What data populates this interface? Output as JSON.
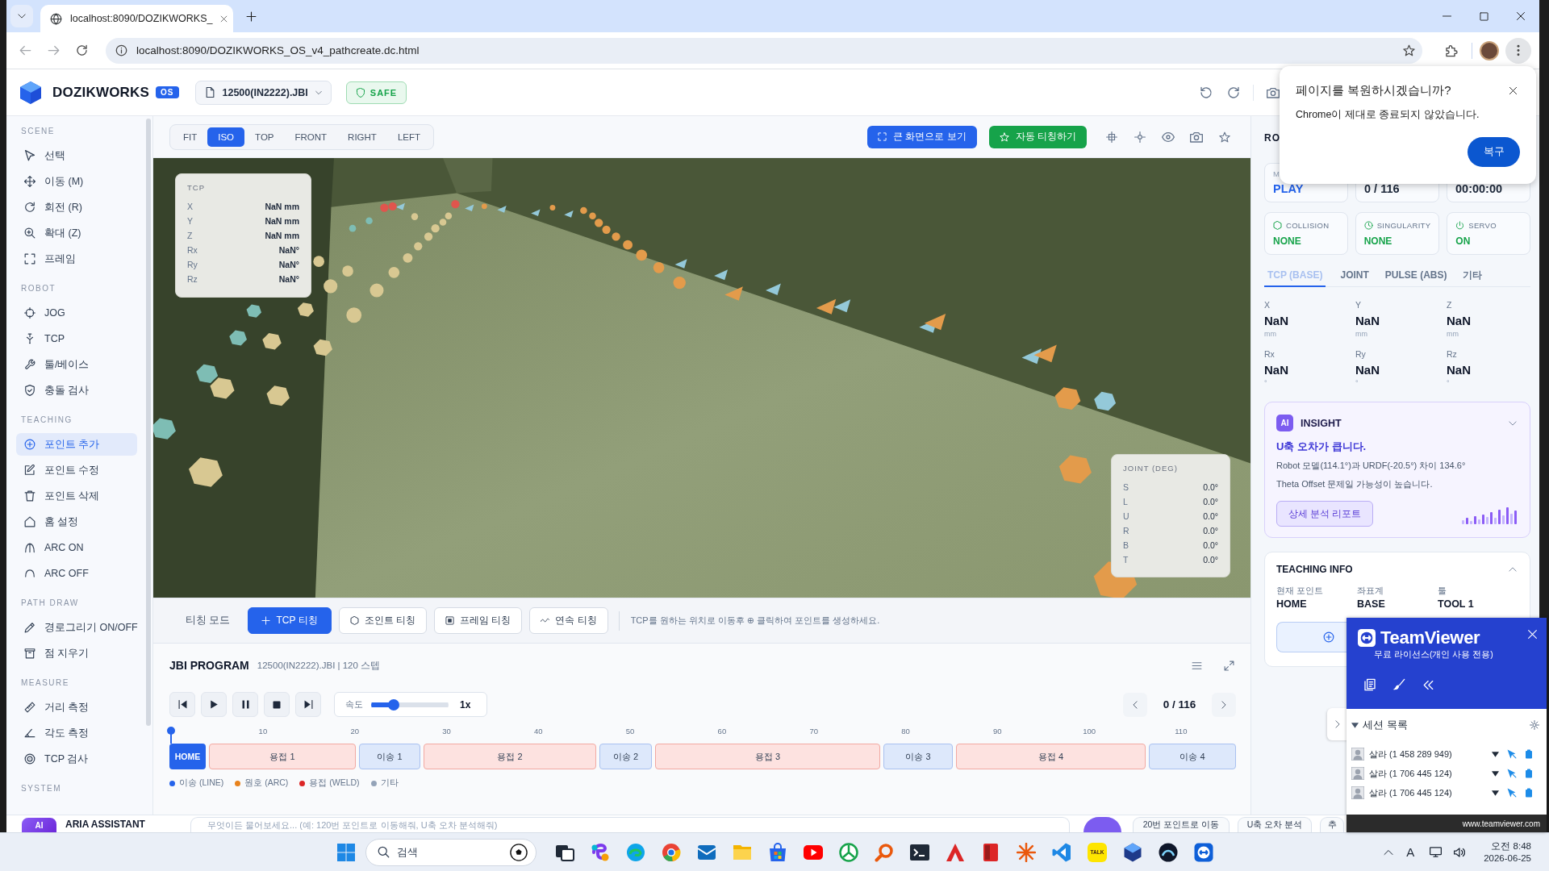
{
  "browser": {
    "tab_title": "localhost:8090/DOZIKWORKS_",
    "url": "localhost:8090/DOZIKWORKS_OS_v4_pathcreate.dc.html",
    "back_disabled": true,
    "forward_disabled": true
  },
  "header": {
    "brand": "DOZIKWORKS",
    "badge": "OS",
    "file": "12500(IN2222).JBI",
    "status": "SAFE"
  },
  "sidebar": {
    "sections": [
      {
        "title": "SCENE",
        "items": [
          {
            "label": "선택",
            "selected": false
          },
          {
            "label": "이동 (M)",
            "selected": false
          },
          {
            "label": "회전 (R)",
            "selected": false
          },
          {
            "label": "확대 (Z)",
            "selected": false
          },
          {
            "label": "프레임",
            "selected": false
          }
        ]
      },
      {
        "title": "ROBOT",
        "items": [
          {
            "label": "JOG",
            "selected": false
          },
          {
            "label": "TCP",
            "selected": false
          },
          {
            "label": "툴/베이스",
            "selected": false
          },
          {
            "label": "충돌 검사",
            "selected": false
          }
        ]
      },
      {
        "title": "TEACHING",
        "items": [
          {
            "label": "포인트 추가",
            "selected": true
          },
          {
            "label": "포인트 수정",
            "selected": false
          },
          {
            "label": "포인트 삭제",
            "selected": false
          },
          {
            "label": "홈 설정",
            "selected": false
          },
          {
            "label": "ARC ON",
            "selected": false
          },
          {
            "label": "ARC OFF",
            "selected": false
          }
        ]
      },
      {
        "title": "PATH DRAW",
        "items": [
          {
            "label": "경로그리기 ON/OFF",
            "selected": false
          },
          {
            "label": "점 지우기",
            "selected": false
          }
        ]
      },
      {
        "title": "MEASURE",
        "items": [
          {
            "label": "거리 측정",
            "selected": false
          },
          {
            "label": "각도 측정",
            "selected": false
          },
          {
            "label": "TCP 검사",
            "selected": false
          }
        ]
      },
      {
        "title": "SYSTEM"
      }
    ]
  },
  "view_toolbar": {
    "views": [
      {
        "label": "FIT",
        "selected": false
      },
      {
        "label": "ISO",
        "selected": true
      },
      {
        "label": "TOP",
        "selected": false
      },
      {
        "label": "FRONT",
        "selected": false
      },
      {
        "label": "RIGHT",
        "selected": false
      },
      {
        "label": "LEFT",
        "selected": false
      }
    ],
    "fullscreen_button": "큰 화면으로 보기",
    "auto_teach_button": "자동 티칭하기"
  },
  "viewport": {
    "tcp": {
      "title": "TCP",
      "rows": [
        {
          "axis": "X",
          "value": "NaN mm"
        },
        {
          "axis": "Y",
          "value": "NaN mm"
        },
        {
          "axis": "Z",
          "value": "NaN mm"
        },
        {
          "axis": "Rx",
          "value": "NaN°"
        },
        {
          "axis": "Ry",
          "value": "NaN°"
        },
        {
          "axis": "Rz",
          "value": "NaN°"
        }
      ]
    },
    "joint": {
      "title": "JOINT (DEG)",
      "rows": [
        {
          "axis": "S",
          "value": "0.0°"
        },
        {
          "axis": "L",
          "value": "0.0°"
        },
        {
          "axis": "U",
          "value": "0.0°"
        },
        {
          "axis": "R",
          "value": "0.0°"
        },
        {
          "axis": "B",
          "value": "0.0°"
        },
        {
          "axis": "T",
          "value": "0.0°"
        }
      ]
    }
  },
  "teach_bar": {
    "label": "티칭 모드",
    "modes": [
      {
        "label": "TCP 티칭",
        "selected": true
      },
      {
        "label": "조인트 티칭",
        "selected": false
      },
      {
        "label": "프레임 티칭",
        "selected": false
      },
      {
        "label": "연속 티칭",
        "selected": false
      }
    ],
    "hint": "TCP를 원하는 위치로 이동후 ⊕ 클릭하여 포인트를 생성하세요."
  },
  "program": {
    "title": "JBI PROGRAM",
    "subtitle": "12500(IN2222).JBI | 120 스텝",
    "speed": {
      "label": "속도",
      "level": 0.26,
      "value": "1x"
    },
    "position": "0 / 116",
    "ticks": [
      "10",
      "20",
      "30",
      "40",
      "50",
      "60",
      "70",
      "80",
      "90",
      "100",
      "110"
    ],
    "playhead": {
      "level": 0
    },
    "segments": [
      {
        "label": "HOME",
        "kind": "home"
      },
      {
        "label": "용접 1",
        "kind": "weld"
      },
      {
        "label": "이송 1",
        "kind": "move"
      },
      {
        "label": "용접 2",
        "kind": "weld"
      },
      {
        "label": "이송 2",
        "kind": "move"
      },
      {
        "label": "용접 3",
        "kind": "weld"
      },
      {
        "label": "이송 3",
        "kind": "move"
      },
      {
        "label": "용접 4",
        "kind": "weld"
      },
      {
        "label": "이송 4",
        "kind": "move"
      }
    ],
    "legend": [
      {
        "label": "이송 (LINE)",
        "color": "#2563eb"
      },
      {
        "label": "원호 (ARC)",
        "color": "#e8821c"
      },
      {
        "label": "용접 (WELD)",
        "color": "#dc2626"
      },
      {
        "label": "기타",
        "color": "#94a3b8"
      }
    ]
  },
  "assistant": {
    "avatar": "AI",
    "title": "ARIA ASSISTANT",
    "placeholder": "무엇이든 물어보세요... (예: 120번 포인트로 이동해줘, U축 오차 분석해줘)",
    "chips": [
      "20번 포인트로 이동",
      "U축 오차 분석",
      "추"
    ]
  },
  "right_panel": {
    "title": "RO",
    "readouts": [
      {
        "label": "M",
        "value": "PLAY",
        "color": "#2563eb"
      },
      {
        "value": "0 / 116",
        "color": "#1e293b"
      },
      {
        "value": "00:00:00",
        "color": "#1e293b"
      }
    ],
    "checks": [
      {
        "label": "COLLISION",
        "value": "NONE"
      },
      {
        "label": "SINGULARITY",
        "value": "NONE"
      },
      {
        "label": "SERVO",
        "value": "ON"
      }
    ],
    "tabs": [
      {
        "label": "TCP (BASE)",
        "selected": true
      },
      {
        "label": "JOINT",
        "selected": false
      },
      {
        "label": "PULSE (ABS)",
        "selected": false
      },
      {
        "label": "기타",
        "selected": false
      }
    ],
    "coordinates": [
      {
        "label": "X",
        "value": "NaN",
        "unit": "mm"
      },
      {
        "label": "Y",
        "value": "NaN",
        "unit": "mm"
      },
      {
        "label": "Z",
        "value": "NaN",
        "unit": "mm"
      },
      {
        "label": "Rx",
        "value": "NaN",
        "unit": "°"
      },
      {
        "label": "Ry",
        "value": "NaN",
        "unit": "°"
      },
      {
        "label": "Rz",
        "value": "NaN",
        "unit": "°"
      }
    ],
    "insight": {
      "badge": "AI",
      "title": "INSIGHT",
      "headline": "U축 오차가 큽니다.",
      "lines": [
        "Robot 모델(114.1°)과 URDF(-20.5°) 차이 134.6°",
        "Theta Offset 문제일 가능성이 높습니다."
      ],
      "button": "상세 분석 리포트"
    },
    "teaching_info": {
      "title": "TEACHING INFO",
      "fields": [
        {
          "label": "현재 포인트",
          "value": "HOME"
        },
        {
          "label": "좌표계",
          "value": "BASE"
        },
        {
          "label": "툴",
          "value": "TOOL 1"
        }
      ]
    }
  },
  "restore_dialog": {
    "title": "페이지를 복원하시겠습니까?",
    "message": "Chrome이 제대로 종료되지 않았습니다.",
    "button": "복구"
  },
  "teamviewer": {
    "brand": "TeamViewer",
    "subtitle": "무료 라이선스(개인 사용 전용)",
    "section": "세션 목록",
    "sessions": [
      "살라 (1 458 289 949)",
      "살라 (1 706 445 124)",
      "살라 (1 706 445 124)"
    ],
    "footer": "www.teamviewer.com"
  },
  "taskbar": {
    "search_placeholder": "검색",
    "chat_app_label": "TALK",
    "ime": "A",
    "time": "오전 8:48",
    "date": "2026-06-25"
  }
}
